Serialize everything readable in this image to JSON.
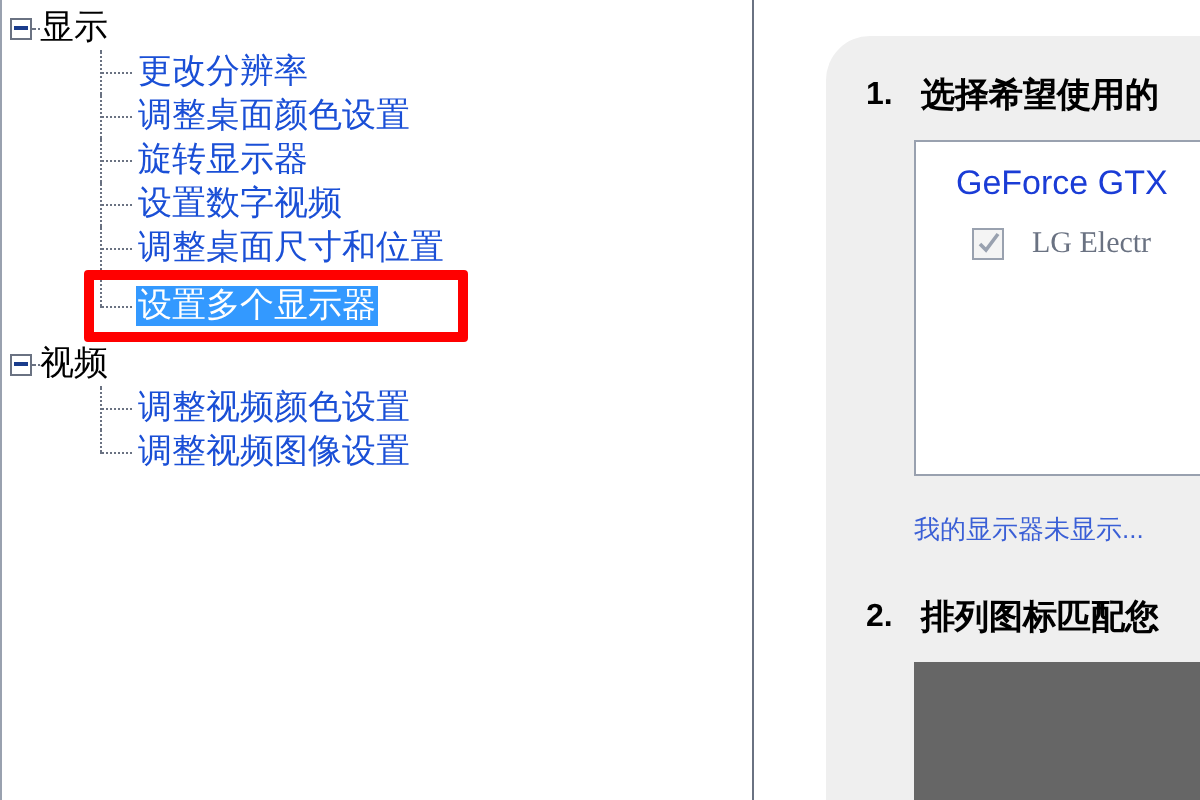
{
  "tree": [
    {
      "label": "显示",
      "expanded": true,
      "children": [
        {
          "label": "更改分辨率",
          "selected": false,
          "annotated": false
        },
        {
          "label": "调整桌面颜色设置",
          "selected": false,
          "annotated": false
        },
        {
          "label": "旋转显示器",
          "selected": false,
          "annotated": false
        },
        {
          "label": "设置数字视频",
          "selected": false,
          "annotated": false
        },
        {
          "label": "调整桌面尺寸和位置",
          "selected": false,
          "annotated": false
        },
        {
          "label": "设置多个显示器",
          "selected": true,
          "annotated": true
        }
      ]
    },
    {
      "label": "视频",
      "expanded": true,
      "children": [
        {
          "label": "调整视频颜色设置",
          "selected": false,
          "annotated": false
        },
        {
          "label": "调整视频图像设置",
          "selected": false,
          "annotated": false
        }
      ]
    }
  ],
  "page": {
    "step1": {
      "number": "1.",
      "title": "选择希望使用的",
      "gpu": "GeForce GTX",
      "displays": [
        {
          "label": "LG Electr",
          "checked": true,
          "disabled": true
        }
      ],
      "link": "我的显示器未显示..."
    },
    "step2": {
      "number": "2.",
      "title": "排列图标匹配您"
    }
  }
}
